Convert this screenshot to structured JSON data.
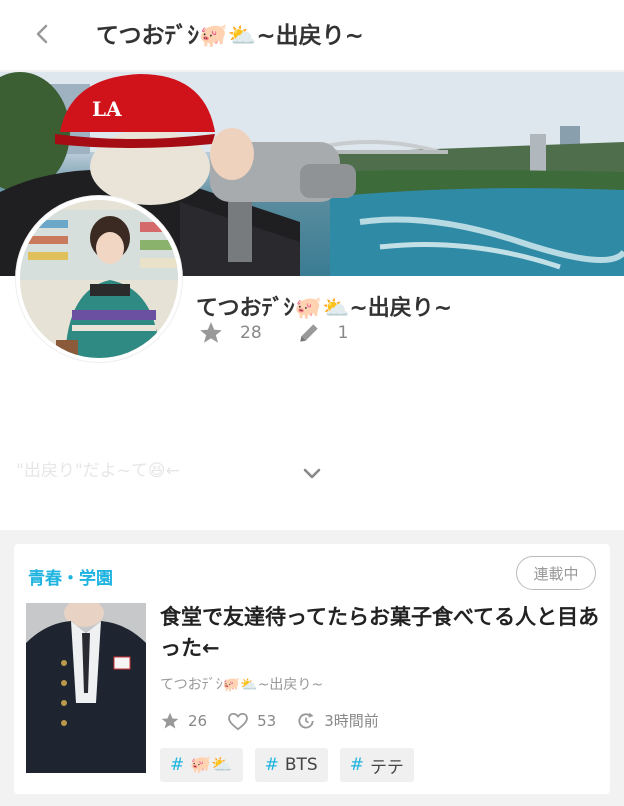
{
  "header": {
    "title": "てつおﾃﾞｼ🐖⛅~出戻り~"
  },
  "profile": {
    "name": "てつおﾃﾞｼ🐖⛅~出戻り~",
    "stars": "28",
    "works": "1",
    "bio_preview": "\"出戻り\"だよ~て😆←"
  },
  "story": {
    "genre": "青春・学園",
    "status": "連載中",
    "title": "食堂で友達待ってたらお菓子食べてる人と目あった←",
    "author": "てつおﾃﾞｼ🐖⛅~出戻り~",
    "stars": "26",
    "likes": "53",
    "updated": "3時間前",
    "tags": [
      {
        "hash": "#",
        "label": "🐖⛅"
      },
      {
        "hash": "#",
        "label": "BTS"
      },
      {
        "hash": "#",
        "label": "テテ"
      }
    ]
  },
  "colors": {
    "accent": "#1fb4e0",
    "muted": "#888888",
    "background": "#f2f2f2"
  }
}
